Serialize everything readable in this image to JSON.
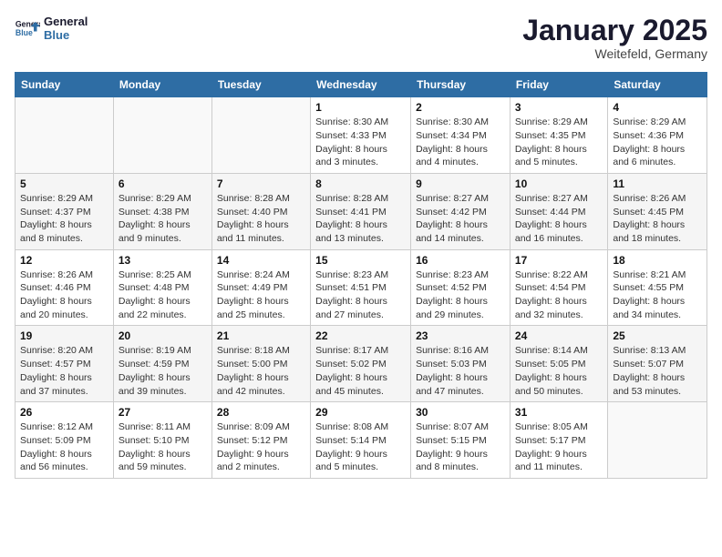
{
  "logo": {
    "line1": "General",
    "line2": "Blue"
  },
  "title": "January 2025",
  "location": "Weitefeld, Germany",
  "weekdays": [
    "Sunday",
    "Monday",
    "Tuesday",
    "Wednesday",
    "Thursday",
    "Friday",
    "Saturday"
  ],
  "weeks": [
    [
      {
        "day": "",
        "info": ""
      },
      {
        "day": "",
        "info": ""
      },
      {
        "day": "",
        "info": ""
      },
      {
        "day": "1",
        "info": "Sunrise: 8:30 AM\nSunset: 4:33 PM\nDaylight: 8 hours and 3 minutes."
      },
      {
        "day": "2",
        "info": "Sunrise: 8:30 AM\nSunset: 4:34 PM\nDaylight: 8 hours and 4 minutes."
      },
      {
        "day": "3",
        "info": "Sunrise: 8:29 AM\nSunset: 4:35 PM\nDaylight: 8 hours and 5 minutes."
      },
      {
        "day": "4",
        "info": "Sunrise: 8:29 AM\nSunset: 4:36 PM\nDaylight: 8 hours and 6 minutes."
      }
    ],
    [
      {
        "day": "5",
        "info": "Sunrise: 8:29 AM\nSunset: 4:37 PM\nDaylight: 8 hours and 8 minutes."
      },
      {
        "day": "6",
        "info": "Sunrise: 8:29 AM\nSunset: 4:38 PM\nDaylight: 8 hours and 9 minutes."
      },
      {
        "day": "7",
        "info": "Sunrise: 8:28 AM\nSunset: 4:40 PM\nDaylight: 8 hours and 11 minutes."
      },
      {
        "day": "8",
        "info": "Sunrise: 8:28 AM\nSunset: 4:41 PM\nDaylight: 8 hours and 13 minutes."
      },
      {
        "day": "9",
        "info": "Sunrise: 8:27 AM\nSunset: 4:42 PM\nDaylight: 8 hours and 14 minutes."
      },
      {
        "day": "10",
        "info": "Sunrise: 8:27 AM\nSunset: 4:44 PM\nDaylight: 8 hours and 16 minutes."
      },
      {
        "day": "11",
        "info": "Sunrise: 8:26 AM\nSunset: 4:45 PM\nDaylight: 8 hours and 18 minutes."
      }
    ],
    [
      {
        "day": "12",
        "info": "Sunrise: 8:26 AM\nSunset: 4:46 PM\nDaylight: 8 hours and 20 minutes."
      },
      {
        "day": "13",
        "info": "Sunrise: 8:25 AM\nSunset: 4:48 PM\nDaylight: 8 hours and 22 minutes."
      },
      {
        "day": "14",
        "info": "Sunrise: 8:24 AM\nSunset: 4:49 PM\nDaylight: 8 hours and 25 minutes."
      },
      {
        "day": "15",
        "info": "Sunrise: 8:23 AM\nSunset: 4:51 PM\nDaylight: 8 hours and 27 minutes."
      },
      {
        "day": "16",
        "info": "Sunrise: 8:23 AM\nSunset: 4:52 PM\nDaylight: 8 hours and 29 minutes."
      },
      {
        "day": "17",
        "info": "Sunrise: 8:22 AM\nSunset: 4:54 PM\nDaylight: 8 hours and 32 minutes."
      },
      {
        "day": "18",
        "info": "Sunrise: 8:21 AM\nSunset: 4:55 PM\nDaylight: 8 hours and 34 minutes."
      }
    ],
    [
      {
        "day": "19",
        "info": "Sunrise: 8:20 AM\nSunset: 4:57 PM\nDaylight: 8 hours and 37 minutes."
      },
      {
        "day": "20",
        "info": "Sunrise: 8:19 AM\nSunset: 4:59 PM\nDaylight: 8 hours and 39 minutes."
      },
      {
        "day": "21",
        "info": "Sunrise: 8:18 AM\nSunset: 5:00 PM\nDaylight: 8 hours and 42 minutes."
      },
      {
        "day": "22",
        "info": "Sunrise: 8:17 AM\nSunset: 5:02 PM\nDaylight: 8 hours and 45 minutes."
      },
      {
        "day": "23",
        "info": "Sunrise: 8:16 AM\nSunset: 5:03 PM\nDaylight: 8 hours and 47 minutes."
      },
      {
        "day": "24",
        "info": "Sunrise: 8:14 AM\nSunset: 5:05 PM\nDaylight: 8 hours and 50 minutes."
      },
      {
        "day": "25",
        "info": "Sunrise: 8:13 AM\nSunset: 5:07 PM\nDaylight: 8 hours and 53 minutes."
      }
    ],
    [
      {
        "day": "26",
        "info": "Sunrise: 8:12 AM\nSunset: 5:09 PM\nDaylight: 8 hours and 56 minutes."
      },
      {
        "day": "27",
        "info": "Sunrise: 8:11 AM\nSunset: 5:10 PM\nDaylight: 8 hours and 59 minutes."
      },
      {
        "day": "28",
        "info": "Sunrise: 8:09 AM\nSunset: 5:12 PM\nDaylight: 9 hours and 2 minutes."
      },
      {
        "day": "29",
        "info": "Sunrise: 8:08 AM\nSunset: 5:14 PM\nDaylight: 9 hours and 5 minutes."
      },
      {
        "day": "30",
        "info": "Sunrise: 8:07 AM\nSunset: 5:15 PM\nDaylight: 9 hours and 8 minutes."
      },
      {
        "day": "31",
        "info": "Sunrise: 8:05 AM\nSunset: 5:17 PM\nDaylight: 9 hours and 11 minutes."
      },
      {
        "day": "",
        "info": ""
      }
    ]
  ]
}
